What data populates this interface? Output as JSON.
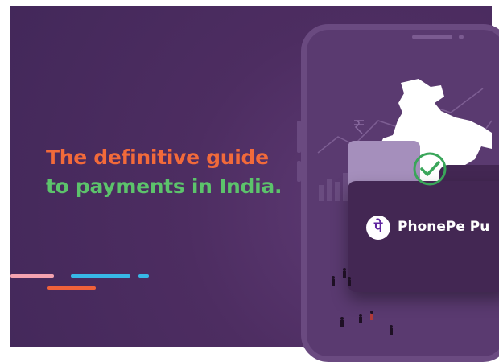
{
  "headline": {
    "line1": "The definitive guide",
    "line2": "to payments in India."
  },
  "brand": {
    "logo_glyph": "पे",
    "name": "PhonePe Pu"
  },
  "colors": {
    "background": "#4a2b5e",
    "headline_line1": "#f26a3a",
    "headline_line2": "#5cc36b",
    "dash_pink": "#f4a3b0",
    "dash_blue": "#37b8e6",
    "dash_orange": "#f0613a",
    "map_fill": "#ffffff",
    "check_green": "#3aa65a",
    "card": "#432753",
    "brand_purple": "#5f259f"
  },
  "icons": [
    "india-map-icon",
    "check-circle-icon",
    "rupee-icon",
    "phonepe-logo-icon"
  ]
}
